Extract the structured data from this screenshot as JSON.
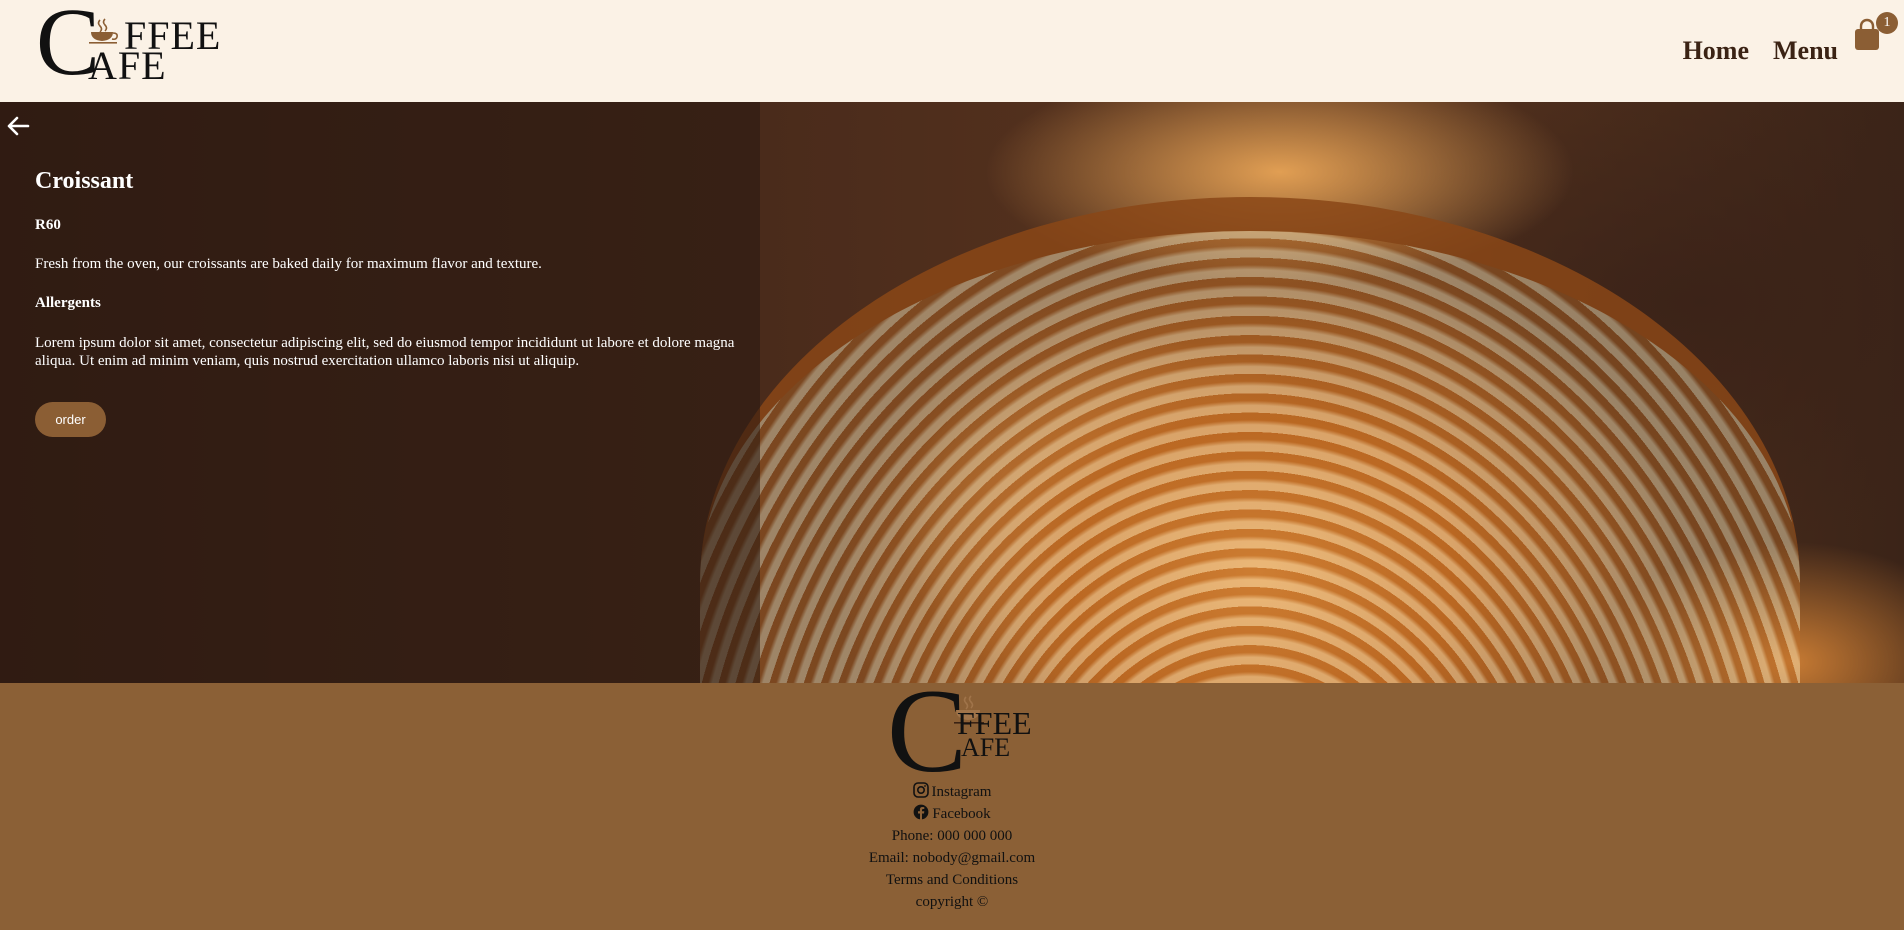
{
  "brand": {
    "logo_c": "C",
    "logo_ffee": "FFEE",
    "logo_afe": "AFE"
  },
  "nav": {
    "home_label": "Home",
    "menu_label": "Menu",
    "cart_count": "1"
  },
  "product": {
    "title": "Croissant",
    "price": "R60",
    "description": "Fresh from the oven, our croissants are baked daily for maximum flavor and texture.",
    "allergents_heading": "Allergents",
    "allergents_text": "Lorem ipsum dolor sit amet, consectetur adipiscing elit, sed do eiusmod tempor incididunt ut labore et dolore magna aliqua. Ut enim ad minim veniam, quis nostrud exercitation ullamco laboris nisi ut aliquip.",
    "order_label": "order"
  },
  "footer": {
    "instagram_label": "Instagram",
    "facebook_label": "Facebook",
    "phone": "Phone: 000 000 000",
    "email": "Email: nobody@gmail.com",
    "terms": "Terms and Conditions",
    "copyright": "copyright ©"
  },
  "colors": {
    "header_bg": "#fbf2e6",
    "accent_brown": "#8b5e34",
    "footer_bg": "#8b6036",
    "nav_text": "#3b2314"
  }
}
